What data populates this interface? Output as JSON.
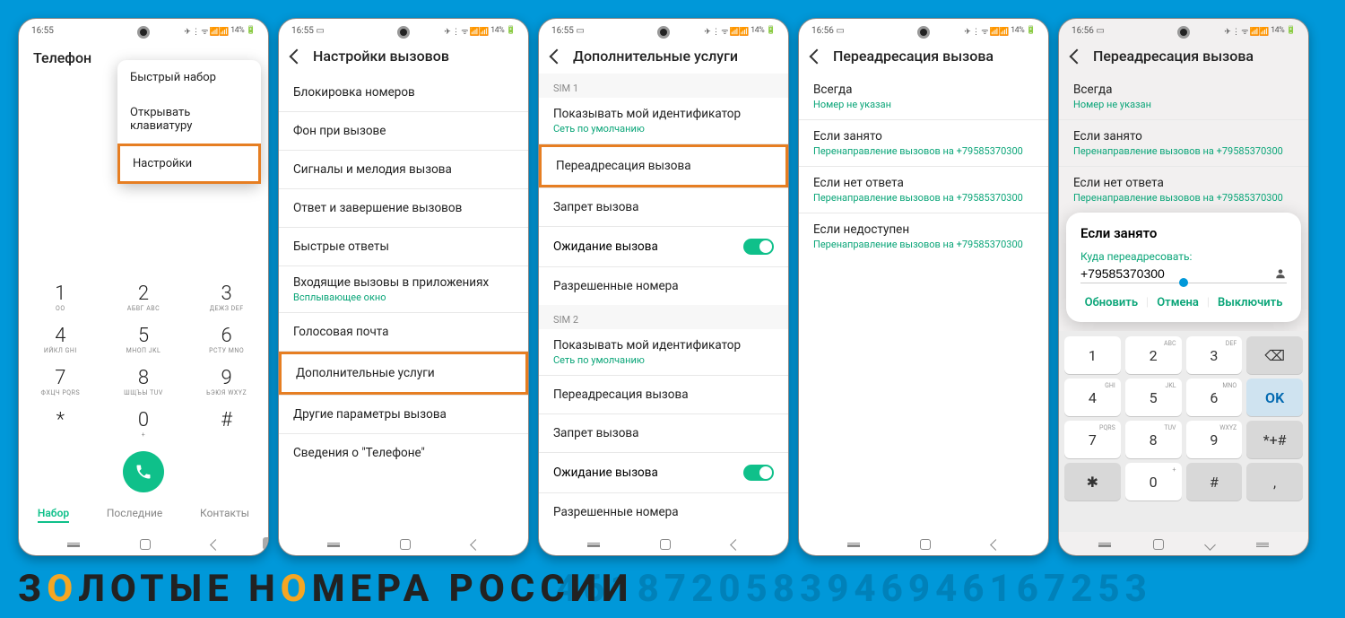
{
  "status": {
    "t1": "16:55",
    "t2": "16:55",
    "t3": "16:55",
    "t4": "16:56",
    "t5": "16:56",
    "batt": "14%",
    "icons": "⚡ ⋮ ᯤ ⫴ ⫴"
  },
  "p1": {
    "title": "Телефон",
    "menu": [
      "Быстрый набор",
      "Открывать клавиатуру",
      "Настройки"
    ],
    "keys": [
      {
        "n": "1",
        "l": "ОО"
      },
      {
        "n": "2",
        "l": "АБВГ ABC"
      },
      {
        "n": "3",
        "l": "ДЕЖЗ DEF"
      },
      {
        "n": "4",
        "l": "ИЙКЛ GHI"
      },
      {
        "n": "5",
        "l": "МНОП JKL"
      },
      {
        "n": "6",
        "l": "РСТУ MNO"
      },
      {
        "n": "7",
        "l": "ФХЦЧ PQRS"
      },
      {
        "n": "8",
        "l": "ШЩЪЫ TUV"
      },
      {
        "n": "9",
        "l": "ЬЭЮЯ WXYZ"
      },
      {
        "n": "*",
        "l": ""
      },
      {
        "n": "0",
        "l": "+"
      },
      {
        "n": "#",
        "l": ""
      }
    ],
    "tabs": [
      "Набор",
      "Последние",
      "Контакты"
    ]
  },
  "p2": {
    "title": "Настройки вызовов",
    "items": [
      {
        "t": "Блокировка номеров"
      },
      {
        "t": "Фон при вызове"
      },
      {
        "t": "Сигналы и мелодия вызова"
      },
      {
        "t": "Ответ и завершение вызовов"
      },
      {
        "t": "Быстрые ответы"
      },
      {
        "t": "Входящие вызовы в приложениях",
        "s": "Всплывающее окно"
      },
      {
        "t": "Голосовая почта"
      },
      {
        "t": "Дополнительные услуги",
        "hl": true
      },
      {
        "t": "Другие параметры вызова"
      },
      {
        "t": "Сведения о \"Телефоне\""
      }
    ]
  },
  "p3": {
    "title": "Дополнительные услуги",
    "sec1": "SIM 1",
    "sec2": "SIM 2",
    "items1": [
      {
        "t": "Показывать мой идентификатор",
        "s": "Сеть по умолчанию"
      },
      {
        "t": "Переадресация вызова",
        "hl": true
      },
      {
        "t": "Запрет вызова"
      },
      {
        "t": "Ожидание вызова",
        "toggle": true
      },
      {
        "t": "Разрешенные номера"
      }
    ],
    "items2": [
      {
        "t": "Показывать мой идентификатор",
        "s": "Сеть по умолчанию"
      },
      {
        "t": "Переадресация вызова"
      },
      {
        "t": "Запрет вызова"
      },
      {
        "t": "Ожидание вызова",
        "toggle": true
      },
      {
        "t": "Разрешенные номера"
      }
    ]
  },
  "p4": {
    "title": "Переадресация вызова",
    "items": [
      {
        "t": "Всегда",
        "s": "Номер не указан"
      },
      {
        "t": "Если занято",
        "s": "Перенаправление вызовов на +79585370300"
      },
      {
        "t": "Если нет ответа",
        "s": "Перенаправление вызовов на +79585370300"
      },
      {
        "t": "Если недоступен",
        "s": "Перенаправление вызовов на +79585370300"
      }
    ]
  },
  "p5": {
    "title": "Переадресация вызова",
    "items": [
      {
        "t": "Всегда",
        "s": "Номер не указан"
      },
      {
        "t": "Если занято",
        "s": "Перенаправление вызовов на +79585370300"
      },
      {
        "t": "Если нет ответа",
        "s": "Перенаправление вызовов на +79585370300"
      }
    ],
    "dialog": {
      "title": "Если занято",
      "label": "Куда переадресовать:",
      "value": "+79585370300",
      "actions": [
        "Обновить",
        "Отмена",
        "Выключить"
      ]
    },
    "kb": [
      {
        "n": "1"
      },
      {
        "n": "2",
        "s": "ABC"
      },
      {
        "n": "3",
        "s": "DEF"
      },
      {
        "n": "⌫",
        "fn": true
      },
      {
        "n": "4",
        "s": "GHI"
      },
      {
        "n": "5",
        "s": "JKL"
      },
      {
        "n": "6",
        "s": "MNO"
      },
      {
        "n": "OK",
        "ok": true
      },
      {
        "n": "7",
        "s": "PQRS"
      },
      {
        "n": "8",
        "s": "TUV"
      },
      {
        "n": "9",
        "s": "WXYZ"
      },
      {
        "n": "*+#",
        "fn": true
      },
      {
        "n": "✱",
        "fn": true
      },
      {
        "n": "0",
        "s": "+"
      },
      {
        "n": "#",
        "fn": true
      },
      {
        "n": ",",
        "fn": true
      }
    ]
  },
  "footer": {
    "text": "ЗОЛОТЫЕ НОМЕРА РОССИИ",
    "bg": "4618720583946946167253"
  }
}
